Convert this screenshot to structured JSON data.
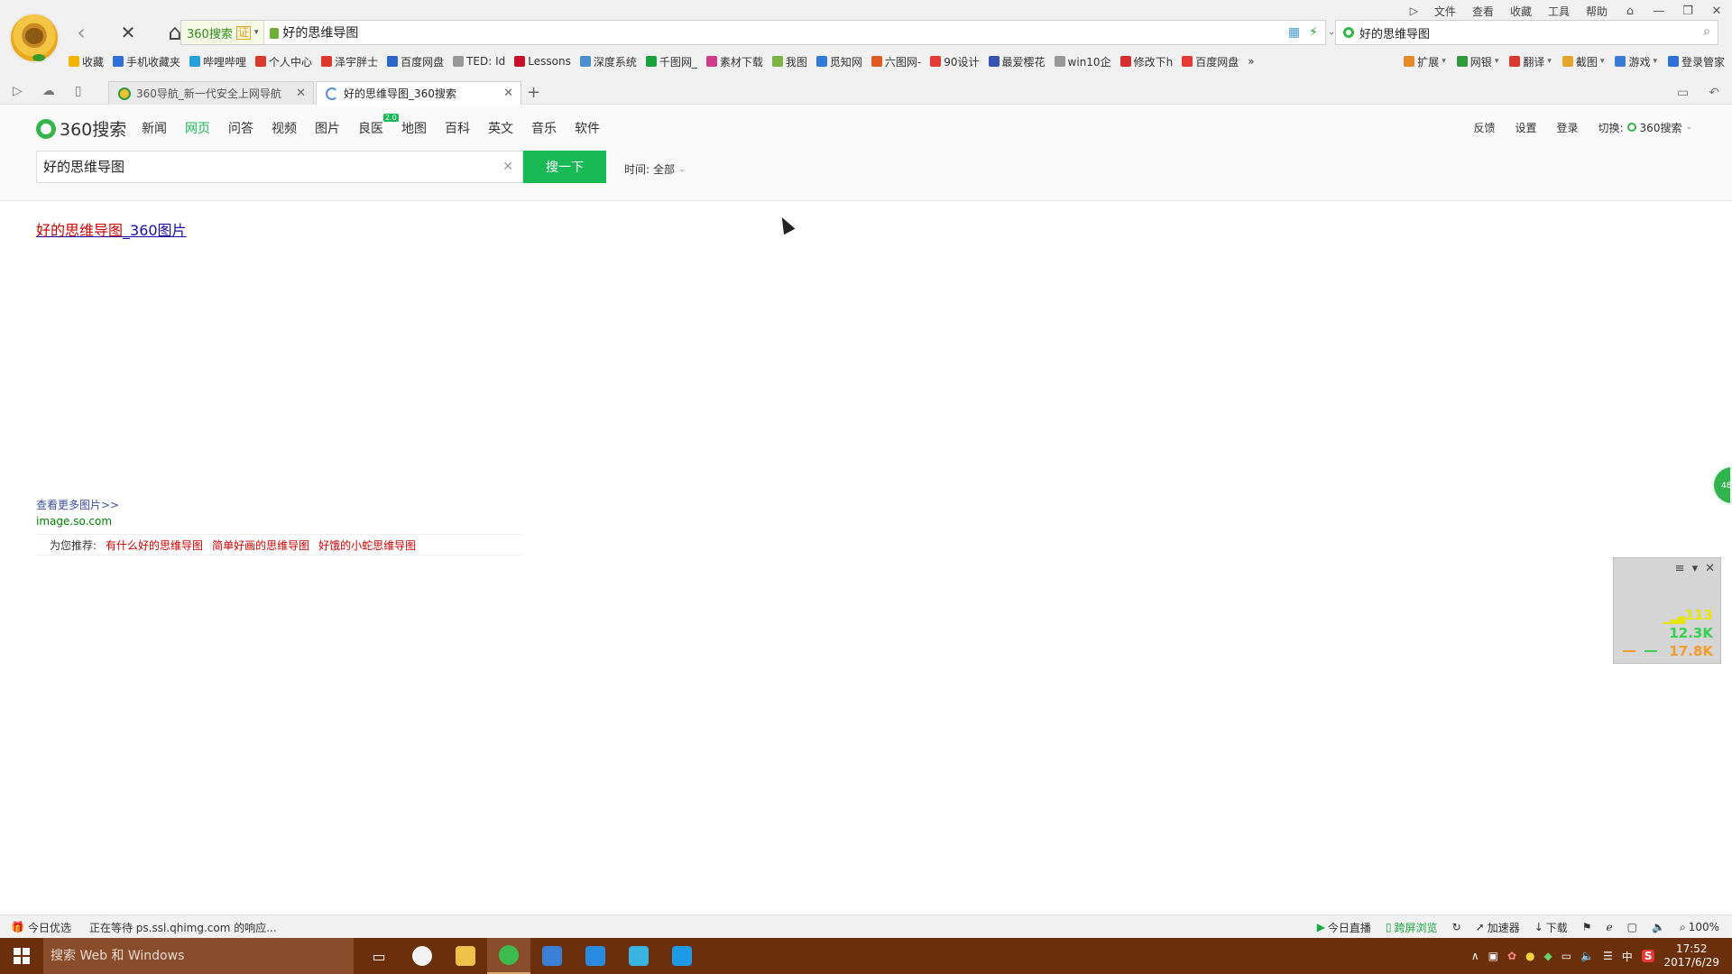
{
  "window_menu": [
    "文件",
    "查看",
    "收藏",
    "工具",
    "帮助"
  ],
  "nav": {
    "back": "‹",
    "stop": "✕",
    "home": "⌂"
  },
  "address": {
    "engine_label": "360搜索",
    "cert_label": "证",
    "url": "好的思维导图"
  },
  "top_search": {
    "value": "好的思维导图"
  },
  "bookmarks": [
    {
      "label": "收藏",
      "color": "#f5b400"
    },
    {
      "label": "手机收藏夹",
      "color": "#2e6fd9"
    },
    {
      "label": "哔哩哔哩",
      "color": "#23a0d8"
    },
    {
      "label": "个人中心",
      "color": "#d93a2b"
    },
    {
      "label": "泽宇胖士",
      "color": "#d93a2b"
    },
    {
      "label": "百度网盘",
      "color": "#2a67c9"
    },
    {
      "label": "TED: Id",
      "color": "#999999"
    },
    {
      "label": "Lessons",
      "color": "#c8102e"
    },
    {
      "label": "深度系统",
      "color": "#4b8fd1"
    },
    {
      "label": "千图网_",
      "color": "#1aa03c"
    },
    {
      "label": "素材下载",
      "color": "#d23a8a"
    },
    {
      "label": "我图",
      "color": "#7cb342"
    },
    {
      "label": "觅知网",
      "color": "#2f7bd8"
    },
    {
      "label": "六图网-",
      "color": "#e25822"
    },
    {
      "label": "90设计",
      "color": "#e53935"
    },
    {
      "label": "最爱樱花",
      "color": "#3a52b4"
    },
    {
      "label": "win10企",
      "color": "#999999"
    },
    {
      "label": "修改下h",
      "color": "#d32f2f"
    },
    {
      "label": "百度网盘",
      "color": "#e53935"
    }
  ],
  "bookmarks_right": [
    "扩展",
    "网银",
    "翻译",
    "截图",
    "游戏",
    "登录管家"
  ],
  "tabs": [
    {
      "title": "360导航_新一代安全上网导航",
      "active": false
    },
    {
      "title": "好的思维导图_360搜索",
      "active": true
    }
  ],
  "page": {
    "logo_text": "360搜索",
    "verticals": [
      "新闻",
      "网页",
      "问答",
      "视频",
      "图片",
      "良医",
      "地图",
      "百科",
      "英文",
      "音乐",
      "软件"
    ],
    "active_vertical": "网页",
    "badge": "2.0",
    "header_right": [
      "反馈",
      "设置",
      "登录"
    ],
    "switch_label": "切换:",
    "switch_engine": "360搜索",
    "query": "好的思维导图",
    "search_button": "搜一下",
    "time_label": "时间:",
    "time_value": "全部"
  },
  "result": {
    "title_highlight": "好的思维导图",
    "title_rest": "_360图片",
    "more_images": "查看更多图片>>",
    "url": "image.so.com",
    "recommend_label": "为您推荐:",
    "recommend_links": [
      "有什么好的思维导图",
      "简单好画的思维导图",
      "好饿的小蛇思维导图"
    ]
  },
  "side_bubble": "48",
  "speed_widget": {
    "ping": "113",
    "down": "12.3K",
    "up": "17.8K"
  },
  "status": {
    "left_label": "今日优选",
    "loading": "正在等待 ps.ssl.qhimg.com 的响应...",
    "right": [
      "今日直播",
      "跨屏浏览",
      "加速器",
      "下载"
    ],
    "zoom": "100%"
  },
  "taskbar": {
    "search_placeholder": "搜索 Web 和 Windows",
    "time": "17:52",
    "date": "2017/6/29",
    "ime": "中"
  },
  "colors": {
    "brand_green": "#19b955",
    "taskbar": "#6b2f0b"
  }
}
